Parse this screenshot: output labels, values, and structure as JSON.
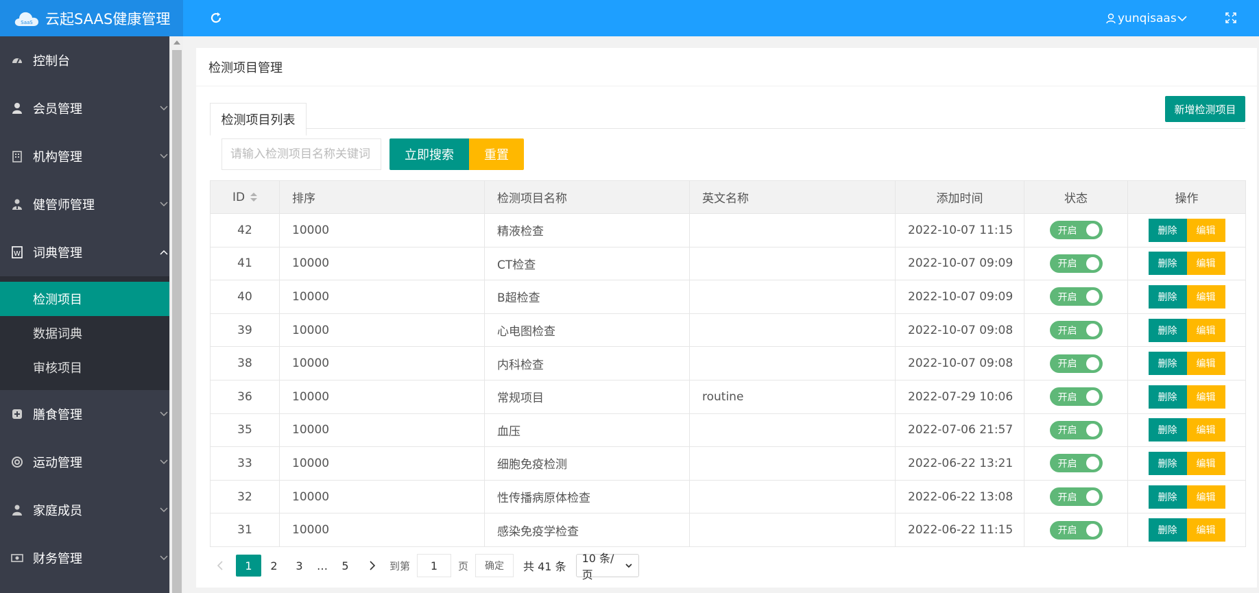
{
  "app": {
    "title": "云起SAAS健康管理",
    "logo_text": "SaaS"
  },
  "header": {
    "username": "yunqisaas",
    "icons": [
      "refresh-icon",
      "user-icon",
      "chevron-down-icon",
      "fullscreen-icon"
    ]
  },
  "sidebar": {
    "items": [
      {
        "label": "控制台",
        "icon": "dashboard-icon"
      },
      {
        "label": "会员管理",
        "icon": "user-icon"
      },
      {
        "label": "机构管理",
        "icon": "building-icon"
      },
      {
        "label": "健管师管理",
        "icon": "doctor-icon"
      },
      {
        "label": "词典管理",
        "icon": "dictionary-icon"
      },
      {
        "label": "膳食管理",
        "icon": "plus-square-icon"
      },
      {
        "label": "运动管理",
        "icon": "lifebuoy-icon"
      },
      {
        "label": "家庭成员",
        "icon": "family-icon"
      },
      {
        "label": "财务管理",
        "icon": "money-icon"
      }
    ],
    "sub_items": [
      {
        "label": "检测项目"
      },
      {
        "label": "数据词典"
      },
      {
        "label": "审核项目"
      }
    ]
  },
  "page": {
    "title": "检测项目管理",
    "tab_label": "检测项目列表",
    "add_button": "新增检测项目"
  },
  "search": {
    "placeholder": "请输入检测项目名称关键词",
    "search_button": "立即搜索",
    "reset_button": "重置"
  },
  "table": {
    "headers": {
      "id": "ID",
      "sort": "排序",
      "name": "检测项目名称",
      "en_name": "英文名称",
      "added": "添加时间",
      "status": "状态",
      "ops": "操作"
    },
    "status_on": "开启",
    "delete_label": "删除",
    "edit_label": "编辑",
    "rows": [
      {
        "id": "42",
        "sort": "10000",
        "name": "精液检查",
        "en_name": "",
        "added": "2022-10-07 11:15"
      },
      {
        "id": "41",
        "sort": "10000",
        "name": "CT检查",
        "en_name": "",
        "added": "2022-10-07 09:09"
      },
      {
        "id": "40",
        "sort": "10000",
        "name": "B超检查",
        "en_name": "",
        "added": "2022-10-07 09:09"
      },
      {
        "id": "39",
        "sort": "10000",
        "name": "心电图检查",
        "en_name": "",
        "added": "2022-10-07 09:08"
      },
      {
        "id": "38",
        "sort": "10000",
        "name": "内科检查",
        "en_name": "",
        "added": "2022-10-07 09:08"
      },
      {
        "id": "36",
        "sort": "10000",
        "name": "常规项目",
        "en_name": "routine",
        "added": "2022-07-29 10:06"
      },
      {
        "id": "35",
        "sort": "10000",
        "name": "血压",
        "en_name": "",
        "added": "2022-07-06 21:57"
      },
      {
        "id": "33",
        "sort": "10000",
        "name": "细胞免疫检测",
        "en_name": "",
        "added": "2022-06-22 13:21"
      },
      {
        "id": "32",
        "sort": "10000",
        "name": "性传播病原体检查",
        "en_name": "",
        "added": "2022-06-22 13:08"
      },
      {
        "id": "31",
        "sort": "10000",
        "name": "感染免疫学检查",
        "en_name": "",
        "added": "2022-06-22 11:15"
      }
    ]
  },
  "pager": {
    "pages": [
      "1",
      "2",
      "3"
    ],
    "dots": "…",
    "last_page": "5",
    "goto_label": "到第",
    "goto_value": "1",
    "page_unit": "页",
    "confirm": "确定",
    "total": "共 41 条",
    "page_size": "10 条/页"
  },
  "colors": {
    "topbar": "#1e9fff",
    "sidebar": "#393d49",
    "primary": "#009688",
    "warning": "#ffb800",
    "switch_on": "#5fb878"
  }
}
